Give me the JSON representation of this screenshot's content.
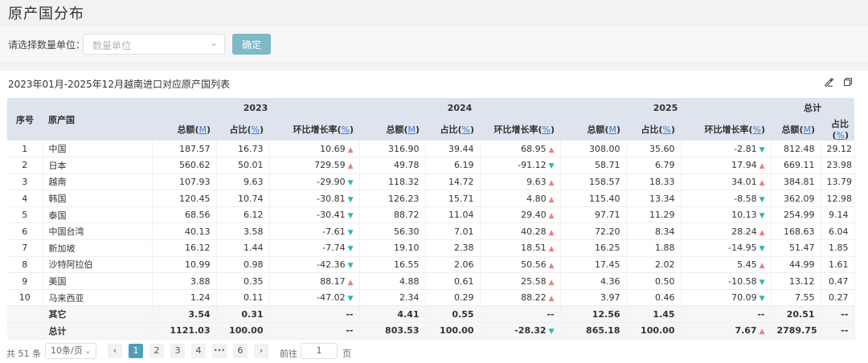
{
  "page_title": "原产国分布",
  "filter": {
    "label": "请选择数量单位：",
    "placeholder": "数量单位",
    "confirm_label": "确定"
  },
  "table_title": "2023年01月-2025年12月越南进口对应原产国列表",
  "icons": {
    "edit": "edit-icon",
    "copy": "copy-icon",
    "up": "triangle-up-icon",
    "down": "triangle-down-icon"
  },
  "colors": {
    "up": "#f07e7e",
    "down": "#2bb7b3",
    "header_bg": "#dde4ee",
    "active_page": "#4f9fb7"
  },
  "headers": {
    "index": "序号",
    "country": "原产国",
    "groups": [
      "2023",
      "2024",
      "2025",
      "总计"
    ],
    "amount": "总额",
    "share": "占比",
    "growth": "环比增长率",
    "unit_m": "M",
    "unit_pct": "%",
    "lparen": "(",
    "rparen": ")"
  },
  "rows": [
    {
      "idx": "1",
      "country": "中国",
      "y23": [
        "187.57",
        "16.73",
        "10.69",
        "up"
      ],
      "y24": [
        "316.90",
        "39.44",
        "68.95",
        "up"
      ],
      "y25": [
        "308.00",
        "35.60",
        "-2.81",
        "down"
      ],
      "total": [
        "812.48",
        "29.12"
      ]
    },
    {
      "idx": "2",
      "country": "日本",
      "y23": [
        "560.62",
        "50.01",
        "729.59",
        "up"
      ],
      "y24": [
        "49.78",
        "6.19",
        "-91.12",
        "down"
      ],
      "y25": [
        "58.71",
        "6.79",
        "17.94",
        "up"
      ],
      "total": [
        "669.11",
        "23.98"
      ]
    },
    {
      "idx": "3",
      "country": "越南",
      "y23": [
        "107.93",
        "9.63",
        "-29.90",
        "down"
      ],
      "y24": [
        "118.32",
        "14.72",
        "9.63",
        "up"
      ],
      "y25": [
        "158.57",
        "18.33",
        "34.01",
        "up"
      ],
      "total": [
        "384.81",
        "13.79"
      ]
    },
    {
      "idx": "4",
      "country": "韩国",
      "y23": [
        "120.45",
        "10.74",
        "-30.81",
        "down"
      ],
      "y24": [
        "126.23",
        "15.71",
        "4.80",
        "up"
      ],
      "y25": [
        "115.40",
        "13.34",
        "-8.58",
        "down"
      ],
      "total": [
        "362.09",
        "12.98"
      ]
    },
    {
      "idx": "5",
      "country": "泰国",
      "y23": [
        "68.56",
        "6.12",
        "-30.41",
        "down"
      ],
      "y24": [
        "88.72",
        "11.04",
        "29.40",
        "up"
      ],
      "y25": [
        "97.71",
        "11.29",
        "10.13",
        "down"
      ],
      "total": [
        "254.99",
        "9.14"
      ]
    },
    {
      "idx": "6",
      "country": "中国台湾",
      "y23": [
        "40.13",
        "3.58",
        "-7.61",
        "down"
      ],
      "y24": [
        "56.30",
        "7.01",
        "40.28",
        "up"
      ],
      "y25": [
        "72.20",
        "8.34",
        "28.24",
        "up"
      ],
      "total": [
        "168.63",
        "6.04"
      ]
    },
    {
      "idx": "7",
      "country": "新加坡",
      "y23": [
        "16.12",
        "1.44",
        "-7.74",
        "down"
      ],
      "y24": [
        "19.10",
        "2.38",
        "18.51",
        "up"
      ],
      "y25": [
        "16.25",
        "1.88",
        "-14.95",
        "down"
      ],
      "total": [
        "51.47",
        "1.85"
      ]
    },
    {
      "idx": "8",
      "country": "沙特阿拉伯",
      "y23": [
        "10.99",
        "0.98",
        "-42.36",
        "down"
      ],
      "y24": [
        "16.55",
        "2.06",
        "50.56",
        "up"
      ],
      "y25": [
        "17.45",
        "2.02",
        "5.45",
        "up"
      ],
      "total": [
        "44.99",
        "1.61"
      ]
    },
    {
      "idx": "9",
      "country": "美国",
      "y23": [
        "3.88",
        "0.35",
        "88.17",
        "up"
      ],
      "y24": [
        "4.88",
        "0.61",
        "25.58",
        "up"
      ],
      "y25": [
        "4.36",
        "0.50",
        "-10.58",
        "down"
      ],
      "total": [
        "13.12",
        "0.47"
      ]
    },
    {
      "idx": "10",
      "country": "马来西亚",
      "y23": [
        "1.24",
        "0.11",
        "-47.02",
        "down"
      ],
      "y24": [
        "2.34",
        "0.29",
        "88.22",
        "up"
      ],
      "y25": [
        "3.97",
        "0.46",
        "70.09",
        "down"
      ],
      "total": [
        "7.55",
        "0.27"
      ]
    }
  ],
  "summary_rows": [
    {
      "label": "其它",
      "y23": [
        "3.54",
        "0.31",
        "--",
        ""
      ],
      "y24": [
        "4.41",
        "0.55",
        "--",
        ""
      ],
      "y25": [
        "12.56",
        "1.45",
        "--",
        ""
      ],
      "total": [
        "20.51",
        "--"
      ]
    },
    {
      "label": "总计",
      "y23": [
        "1121.03",
        "100.00",
        "--",
        ""
      ],
      "y24": [
        "803.53",
        "100.00",
        "-28.32",
        "down"
      ],
      "y25": [
        "865.18",
        "100.00",
        "7.67",
        "up"
      ],
      "total": [
        "2789.75",
        "--"
      ]
    }
  ],
  "pagination": {
    "total_text": "共 51 条",
    "page_size": "10条/页",
    "prev": "‹",
    "next": "›",
    "pages": [
      "1",
      "2",
      "3",
      "4"
    ],
    "ellipsis": "•••",
    "last_page": "6",
    "active": "1",
    "goto_label": "前往",
    "goto_value": "1",
    "page_suffix": "页"
  }
}
